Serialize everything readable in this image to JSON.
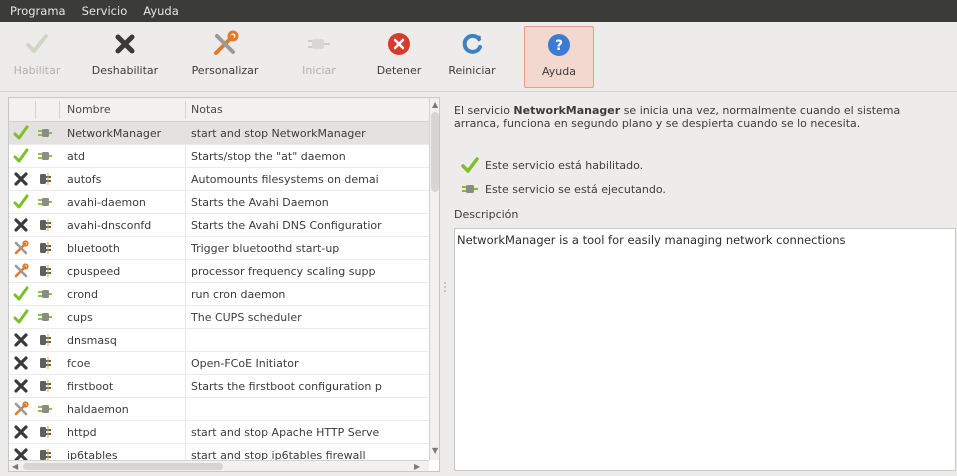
{
  "menu": [
    "Programa",
    "Servicio",
    "Ayuda"
  ],
  "toolbar": {
    "habilitar": "Habilitar",
    "deshabilitar": "Deshabilitar",
    "personalizar": "Personalizar",
    "iniciar": "Iniciar",
    "detener": "Detener",
    "reiniciar": "Reiniciar",
    "ayuda": "Ayuda"
  },
  "table": {
    "columns": [
      "Nombre",
      "Notas"
    ],
    "rows": [
      {
        "enabled": "enabled",
        "running": "running",
        "name": "NetworkManager",
        "note": "start and stop NetworkManager"
      },
      {
        "enabled": "enabled",
        "running": "running",
        "name": "atd",
        "note": "Starts/stop the \"at\" daemon"
      },
      {
        "enabled": "disabled",
        "running": "stopped",
        "name": "autofs",
        "note": "Automounts filesystems on demai"
      },
      {
        "enabled": "enabled",
        "running": "running",
        "name": "avahi-daemon",
        "note": "Starts the Avahi Daemon"
      },
      {
        "enabled": "disabled",
        "running": "stopped",
        "name": "avahi-dnsconfd",
        "note": "Starts the Avahi DNS Configuratior"
      },
      {
        "enabled": "custom",
        "running": "stopped",
        "name": "bluetooth",
        "note": "Trigger bluetoothd start-up"
      },
      {
        "enabled": "custom",
        "running": "stopped",
        "name": "cpuspeed",
        "note": "processor frequency scaling supp"
      },
      {
        "enabled": "enabled",
        "running": "running",
        "name": "crond",
        "note": "run cron daemon"
      },
      {
        "enabled": "enabled",
        "running": "running",
        "name": "cups",
        "note": "The CUPS scheduler"
      },
      {
        "enabled": "disabled",
        "running": "stopped",
        "name": "dnsmasq",
        "note": ""
      },
      {
        "enabled": "disabled",
        "running": "stopped",
        "name": "fcoe",
        "note": "Open-FCoE Initiator"
      },
      {
        "enabled": "disabled",
        "running": "stopped",
        "name": "firstboot",
        "note": "Starts the firstboot configuration p"
      },
      {
        "enabled": "custom",
        "running": "running",
        "name": "haldaemon",
        "note": ""
      },
      {
        "enabled": "disabled",
        "running": "stopped",
        "name": "httpd",
        "note": "start and stop Apache HTTP Serve"
      },
      {
        "enabled": "disabled",
        "running": "stopped",
        "name": "ip6tables",
        "note": "start and stop ip6tables firewall"
      }
    ]
  },
  "detail": {
    "intro_pre": "El servicio ",
    "service_name": "NetworkManager",
    "intro_post": " se inicia una vez, normalmente cuando el sistema arranca, funciona en segundo plano y se despierta cuando se lo necesita.",
    "enabled_text": "Este servicio está habilitado.",
    "running_text": "Este servicio se está ejecutando.",
    "description_label": "Descripción",
    "description": "NetworkManager is a tool for easily managing network connections"
  },
  "colors": {
    "menubar": "#3b3b38",
    "check": "#7cbf2a",
    "cross": "#3a3a3a",
    "stop_red": "#d63b2e",
    "reload_blue": "#3b82c4",
    "help_blue": "#3a7bd5"
  },
  "icons": {
    "enabled": "check-icon",
    "disabled": "cross-icon",
    "custom": "wrench-screwdriver-icon",
    "running": "plug-connected-icon",
    "stopped": "plug-disconnected-icon"
  }
}
